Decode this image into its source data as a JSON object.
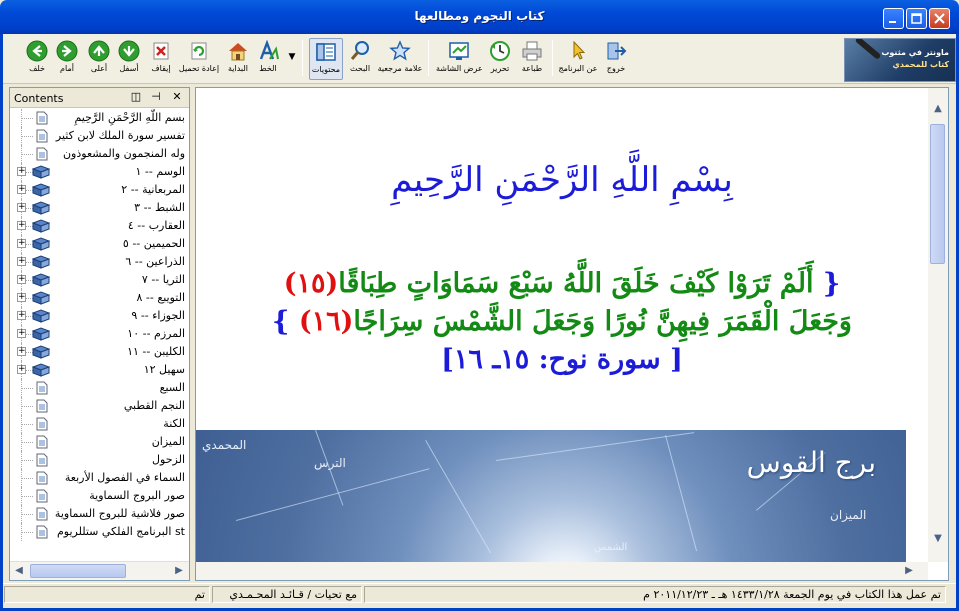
{
  "window": {
    "title": "كتاب النجوم ومطالعها",
    "minimize_icon": "minimize-icon",
    "maximize_icon": "maximize-icon",
    "close_icon": "close-icon"
  },
  "toolbar": {
    "buttons": [
      {
        "label": "خلف",
        "icon": "back-arrow-icon",
        "color": "#2f9e2f"
      },
      {
        "label": "أمام",
        "icon": "forward-arrow-icon",
        "color": "#2f9e2f"
      },
      {
        "label": "أعلى",
        "icon": "up-arrow-icon",
        "color": "#2f9e2f"
      },
      {
        "label": "أسفل",
        "icon": "down-arrow-icon",
        "color": "#2f9e2f"
      },
      {
        "label": "إيقاف",
        "icon": "stop-icon",
        "color": "#d02020"
      },
      {
        "label": "إعادة تحميل",
        "icon": "refresh-icon",
        "color": "#2f9e2f"
      },
      {
        "label": "البداية",
        "icon": "home-icon",
        "color": "#d89020"
      },
      {
        "label": "الخط",
        "icon": "font-icon",
        "color": "#1d5fa8"
      },
      {
        "label": "محتويات",
        "icon": "contents-icon",
        "color": "#1d5fa8"
      },
      {
        "label": "البحث",
        "icon": "search-icon",
        "color": "#1d5fa8"
      },
      {
        "label": "علامة مرجعية",
        "icon": "bookmark-star-icon",
        "color": "#1d5fa8"
      },
      {
        "label": "عرض الشاشة",
        "icon": "screen-view-icon",
        "color": "#1d5fa8"
      },
      {
        "label": "تحرير",
        "icon": "edit-icon",
        "color": "#2f9e2f"
      },
      {
        "label": "طباعة",
        "icon": "print-icon",
        "color": "#666666"
      },
      {
        "label": "عن البرنامج",
        "icon": "about-pointer-icon",
        "color": "#e0b020"
      },
      {
        "label": "خروج",
        "icon": "exit-icon",
        "color": "#1d5fa8"
      }
    ],
    "logo_line1": "ماونتر في مثنوب",
    "logo_line2": "كتاب للمحمدي"
  },
  "contents": {
    "title": "Contents",
    "items": [
      {
        "label": "بسم اللَّهِ الرَّحْمَنِ الرَّحِيمِ",
        "type": "page",
        "expandable": false
      },
      {
        "label": "تفسير سورة الملك لابن كثير",
        "type": "page",
        "expandable": false
      },
      {
        "label": "وله المنجمون والمشعوذون",
        "type": "page",
        "expandable": false
      },
      {
        "label": "الوسم -- ١",
        "type": "book",
        "expandable": true
      },
      {
        "label": "المربعانية -- ٢",
        "type": "book",
        "expandable": true
      },
      {
        "label": "الشبط -- ٣",
        "type": "book",
        "expandable": true
      },
      {
        "label": "العقارب -- ٤",
        "type": "book",
        "expandable": true
      },
      {
        "label": "الحميمين -- ٥",
        "type": "book",
        "expandable": true
      },
      {
        "label": "الذراعين -- ٦",
        "type": "book",
        "expandable": true
      },
      {
        "label": "الثريا -- ٧",
        "type": "book",
        "expandable": true
      },
      {
        "label": "التويبع -- ٨",
        "type": "book",
        "expandable": true
      },
      {
        "label": "الجوزاء -- ٩",
        "type": "book",
        "expandable": true
      },
      {
        "label": "المرزم -- ١٠",
        "type": "book",
        "expandable": true
      },
      {
        "label": "الكليبن -- ١١",
        "type": "book",
        "expandable": true
      },
      {
        "label": "سهيل ١٢",
        "type": "book",
        "expandable": true
      },
      {
        "label": "السبع",
        "type": "page",
        "expandable": false
      },
      {
        "label": "النجم القطبي",
        "type": "page",
        "expandable": false
      },
      {
        "label": "الكنة",
        "type": "page",
        "expandable": false
      },
      {
        "label": "الميزان",
        "type": "page",
        "expandable": false
      },
      {
        "label": "الزحول",
        "type": "page",
        "expandable": false
      },
      {
        "label": "السماء في الفصول الأربعة",
        "type": "page",
        "expandable": false
      },
      {
        "label": "صور البروج السماوية",
        "type": "page",
        "expandable": false
      },
      {
        "label": "صور فلاشية للبروج السماوية",
        "type": "page",
        "expandable": false
      },
      {
        "label": "st البرنامج الفلكي ستللريوم",
        "type": "page",
        "expandable": false
      }
    ]
  },
  "main": {
    "basmala": "بِسْمِ اللَّهِ الرَّحْمَنِ الرَّحِيمِ",
    "verse1_open": "{",
    "verse1_text": "أَلَمْ تَرَوْا كَيْفَ خَلَقَ اللَّهُ سَبْعَ سَمَاوَاتٍ طِبَاقًا",
    "verse1_num": "(١٥)",
    "verse2_text": "وَجَعَلَ الْقَمَرَ فِيهِنَّ نُورًا وَجَعَلَ الشَّمْسَ سِرَاجًا",
    "verse2_num": "(١٦)",
    "verse2_close": "}",
    "reference": "[ سورة نوح: ١٥ـ ١٦]",
    "image": {
      "title": "برج القوس",
      "label_author": "المحمدي",
      "label_turs": "الترس",
      "label_mizan": "الميزان",
      "label_shams": "الشمس"
    }
  },
  "status": {
    "cell_main": "تم عمل هذا الكتاب في يوم الجمعة ١٤٣٣/١/٢٨ هـ ـ ٢٠١١/١٢/٢٣ م",
    "cell_author": "مع تحيات / قـائـد المحـمـدي",
    "cell_done": "تم"
  }
}
